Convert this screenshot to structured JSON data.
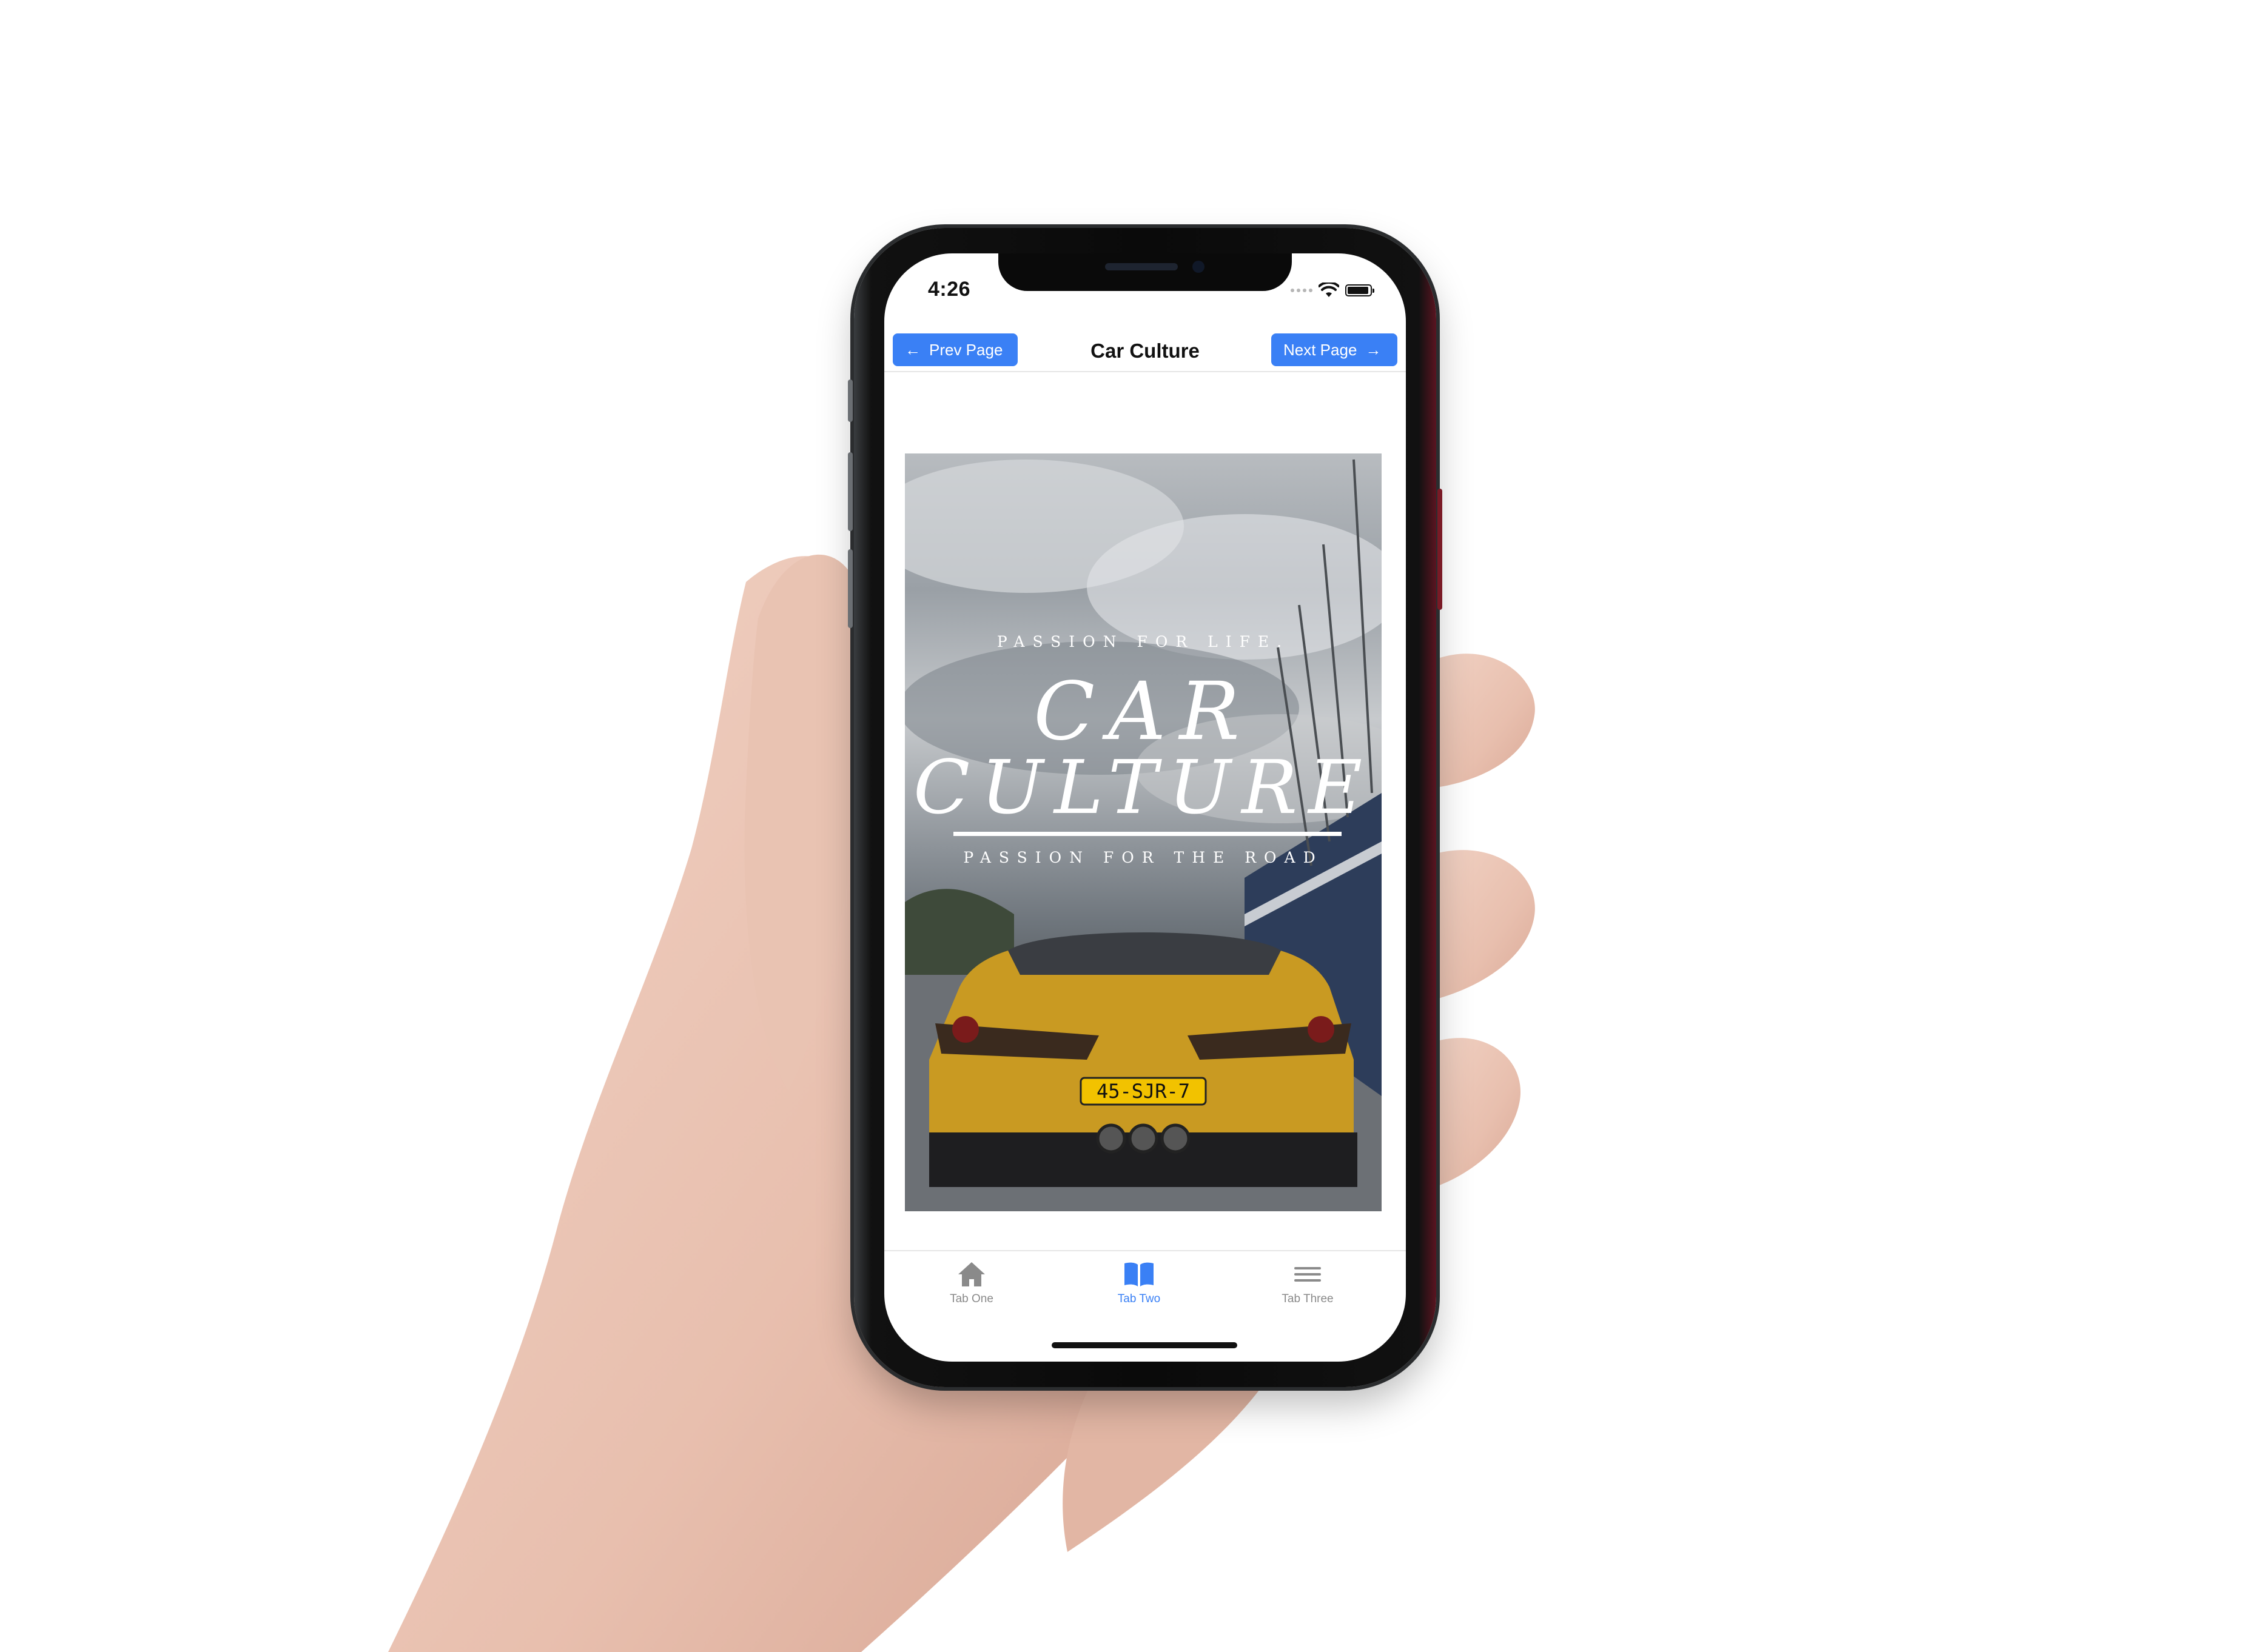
{
  "status_bar": {
    "time": "4:26"
  },
  "nav": {
    "prev_label": "Prev Page",
    "title": "Car Culture",
    "next_label": "Next Page",
    "prev_icon": "arrow-left-icon",
    "next_icon": "arrow-right-icon"
  },
  "cover": {
    "kicker": "PASSION FOR LIFE.",
    "headline_line1": "CAR",
    "headline_line2": "CULTURE",
    "subline": "PASSION FOR THE ROAD",
    "plate": "45-SJR-7"
  },
  "tabs": [
    {
      "label": "Tab One",
      "icon": "home-icon",
      "active": false
    },
    {
      "label": "Tab Two",
      "icon": "book-icon",
      "active": true
    },
    {
      "label": "Tab Three",
      "icon": "menu-icon",
      "active": false
    }
  ],
  "colors": {
    "accent": "#3a80f5",
    "tab_inactive": "#8a8a8a"
  }
}
